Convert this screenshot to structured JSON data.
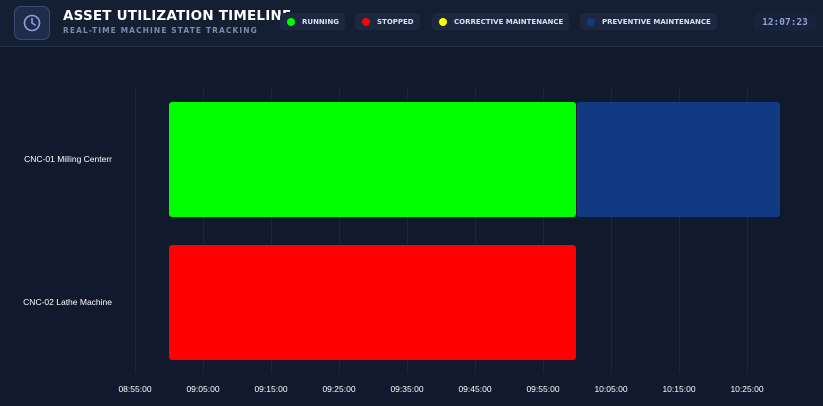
{
  "header": {
    "title": "ASSET UTILIZATION TIMELINE",
    "subtitle": "REAL-TIME MACHINE STATE TRACKING",
    "clock": "12:07:23",
    "logo_icon": "clock-icon"
  },
  "legend": [
    {
      "key": "running",
      "label": "RUNNING",
      "color": "#00ff00"
    },
    {
      "key": "stopped",
      "label": "STOPPED",
      "color": "#ff0000"
    },
    {
      "key": "corrective",
      "label": "CORRECTIVE MAINTENANCE",
      "color": "#ffff00"
    },
    {
      "key": "preventive",
      "label": "PREVENTIVE MAINTENANCE",
      "color": "#123a82"
    }
  ],
  "chart_data": {
    "type": "timeline",
    "x_axis": {
      "ticks": [
        "08:55:00",
        "09:05:00",
        "09:15:00",
        "09:25:00",
        "09:35:00",
        "09:45:00",
        "09:55:00",
        "10:05:00",
        "10:15:00",
        "10:25:00"
      ],
      "range": [
        "08:55:00",
        "10:30:00"
      ]
    },
    "machines": [
      "CNC-01 Milling Centerr",
      "CNC-02 Lathe Machine"
    ],
    "segments": [
      {
        "machine": "CNC-01 Milling Centerr",
        "state": "RUNNING",
        "start": "09:00:00",
        "end": "10:00:00",
        "color": "#00ff00"
      },
      {
        "machine": "CNC-01 Milling Centerr",
        "state": "PREVENTIVE MAINTENANCE",
        "start": "10:00:00",
        "end": "10:30:00",
        "color": "#123a82"
      },
      {
        "machine": "CNC-02 Lathe Machine",
        "state": "STOPPED",
        "start": "09:00:00",
        "end": "10:00:00",
        "color": "#ff0000"
      }
    ]
  }
}
